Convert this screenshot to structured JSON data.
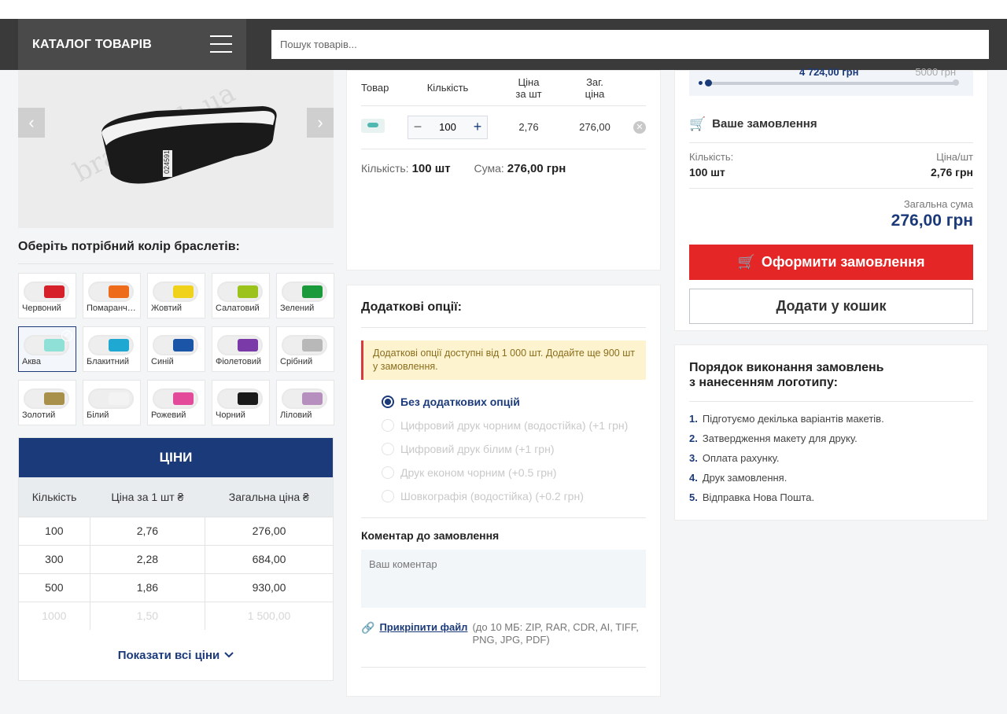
{
  "header": {
    "catalog_title": "КАТАЛОГ ТОВАРІВ",
    "search_placeholder": "Пошук товарів..."
  },
  "gallery": {
    "watermark": "braslet.kh.ua",
    "band_number": "024591"
  },
  "colors": {
    "title": "Оберіть потрібний колір браслетів:",
    "items": [
      {
        "label": "Червоний",
        "hex": "#d6202a"
      },
      {
        "label": "Помаранчевий",
        "hex": "#ef6b1c"
      },
      {
        "label": "Жовтий",
        "hex": "#f1d21a"
      },
      {
        "label": "Салатовий",
        "hex": "#9cc21c"
      },
      {
        "label": "Зелений",
        "hex": "#1a9a3a"
      },
      {
        "label": "Аква",
        "hex": "#8fe0d6",
        "selected": true
      },
      {
        "label": "Блакитний",
        "hex": "#1fa8d2"
      },
      {
        "label": "Синій",
        "hex": "#1a55a8"
      },
      {
        "label": "Фіолетовий",
        "hex": "#7a3aa8"
      },
      {
        "label": "Срібний",
        "hex": "#b8b8b8"
      },
      {
        "label": "Золотий",
        "hex": "#a8904a"
      },
      {
        "label": "Білий",
        "hex": "#f3f3f3"
      },
      {
        "label": "Рожевий",
        "hex": "#e34b9a"
      },
      {
        "label": "Чорний",
        "hex": "#1a1a1a"
      },
      {
        "label": "Ліловий",
        "hex": "#b78fbf"
      }
    ]
  },
  "prices": {
    "title": "ЦІНИ",
    "columns": [
      "Кількість",
      "Ціна за 1 шт ₴",
      "Загальна ціна ₴"
    ],
    "rows": [
      [
        "100",
        "2,76",
        "276,00"
      ],
      [
        "300",
        "2,28",
        "684,00"
      ],
      [
        "500",
        "1,86",
        "930,00"
      ],
      [
        "1000",
        "1,50",
        "1 500,00"
      ]
    ],
    "show_all": "Показати всі ціни"
  },
  "cart": {
    "columns": [
      "Товар",
      "Кількість",
      "Ціна\nза шт",
      "Заг.\nціна"
    ],
    "item": {
      "qty": "100",
      "unit_price": "2,76",
      "total": "276,00"
    },
    "qty_label": "Кількість:",
    "qty_value": "100 шт",
    "sum_label": "Сума:",
    "sum_value": "276,00 грн"
  },
  "options": {
    "title": "Додаткові опції:",
    "notice": "Додаткові опції доступні від 1 000 шт. Додайте ще 900 шт у замовлення.",
    "list": [
      {
        "label": "Без додаткових опцій",
        "active": true
      },
      {
        "label": "Цифровий друк чорним (водостійка) (+1 грн)"
      },
      {
        "label": "Цифровий друк білим (+1 грн)"
      },
      {
        "label": "Друк економ чорним (+0.5 грн)"
      },
      {
        "label": "Шовкографія (водостійка) (+0.2 грн)"
      }
    ],
    "comment_label": "Коментар до замовлення",
    "comment_placeholder": "Ваш коментар",
    "attach_label": "Прикріпити файл",
    "attach_hint": "(до 10 МБ: ZIP, RAR, CDR, AI, TIFF, PNG, JPG, PDF)"
  },
  "order": {
    "progress_left": "4 724,00 грн",
    "progress_right": "5000 грн",
    "title": "Ваше замовлення",
    "qty_label": "Кількість:",
    "qty_value": "100 шт",
    "price_label": "Ціна/шт",
    "price_value": "2,76 грн",
    "total_label": "Загальна сума",
    "total_value": "276,00 грн",
    "checkout": "Оформити замовлення",
    "add_to_cart": "Додати у кошик"
  },
  "steps": {
    "title": "Порядок виконання замовлень\nз нанесенням логотипу:",
    "items": [
      "Підготуємо декілька варіантів макетів.",
      "Затвердження макету для друку.",
      "Оплата рахунку.",
      "Друк замовлення.",
      "Відправка Нова Пошта."
    ]
  }
}
